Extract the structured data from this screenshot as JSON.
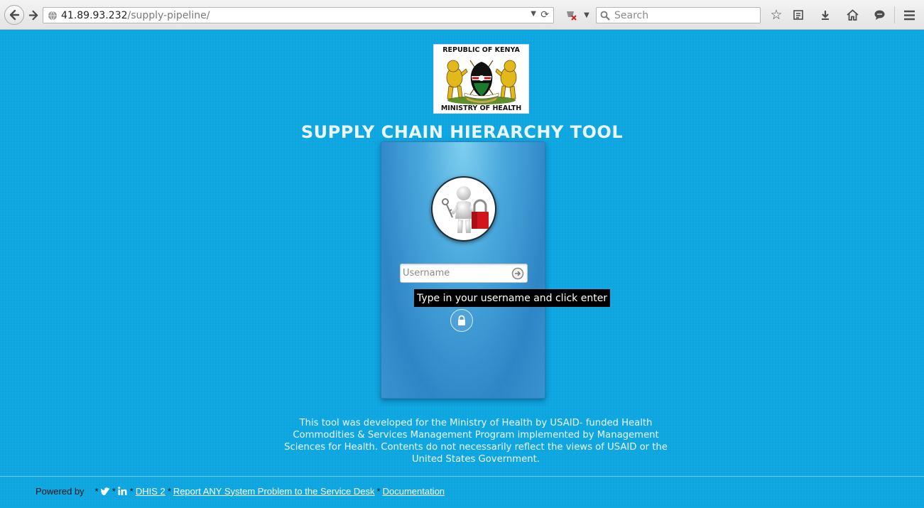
{
  "browser": {
    "url_host": "41.89.93.232",
    "url_path": "/supply-pipeline/",
    "search_placeholder": "Search"
  },
  "header": {
    "emblem_top": "REPUBLIC OF KENYA",
    "emblem_bottom": "MINISTRY OF HEALTH",
    "title": "SUPPLY CHAIN HIERARCHY TOOL"
  },
  "login": {
    "username_placeholder": "Username",
    "tooltip": "Type in your username and click enter"
  },
  "disclaimer": "This tool was developed for the Ministry of Health by USAID- funded Health Commodities & Services Management Program implemented by Management Sciences for Health. Contents do not necessarily reflect the views of USAID or the United States Government.",
  "footer": {
    "powered_by": "Powered by",
    "separator": "*",
    "links": {
      "dhis": "DHIS 2",
      "service_desk": "Report ANY System Problem to the Service Desk",
      "documentation": "Documentation"
    }
  },
  "colors": {
    "page_bg": "#0ea6e0",
    "card_accent": "#2f86c7",
    "tooltip_bg": "#000000"
  },
  "icons": {
    "back": "arrow-left-icon",
    "forward": "arrow-right-icon",
    "reload": "reload-icon",
    "bookmark": "star-icon",
    "lock": "padlock-icon",
    "submit": "arrow-circle-right-icon"
  }
}
